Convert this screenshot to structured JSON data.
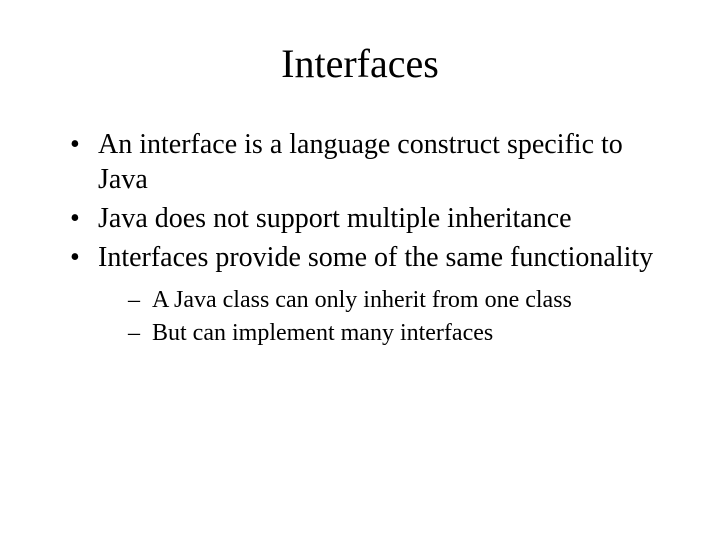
{
  "title": "Interfaces",
  "bullets": [
    "An interface is a language construct specific to Java",
    "Java does not support multiple inheritance",
    "Interfaces provide some of the same functionality"
  ],
  "sub_bullets": [
    "A Java class can only inherit from one class",
    "But can implement many interfaces"
  ]
}
